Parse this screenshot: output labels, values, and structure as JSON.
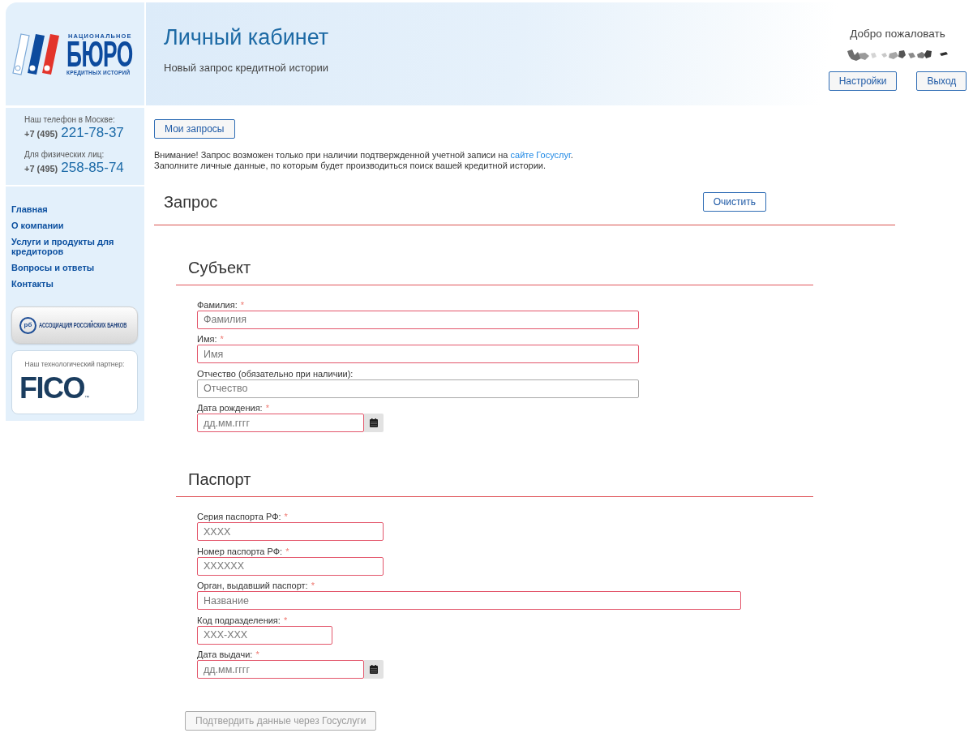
{
  "sidebar": {
    "logo": {
      "top_line": "НАЦИОНАЛЬНОЕ",
      "wordmark": "БЮРО",
      "bottom_line": "КРЕДИТНЫХ ИСТОРИЙ"
    },
    "phones": [
      {
        "label": "Наш телефон в Москве:",
        "code": "+7 (495)",
        "number": "221-78-37"
      },
      {
        "label": "Для физических лиц:",
        "code": "+7 (495)",
        "number": "258-85-74"
      }
    ],
    "nav": [
      {
        "label": "Главная"
      },
      {
        "label": "О компании"
      },
      {
        "label": "Услуги и продукты для кредиторов"
      },
      {
        "label": "Вопросы и ответы"
      },
      {
        "label": "Контакты"
      }
    ],
    "partners": [
      {
        "kind": "banner",
        "emblem": "рб",
        "name": "АССОЦИАЦИЯ РОССИЙСКИХ БАНКОВ"
      },
      {
        "kind": "card",
        "caption": "Наш технологический партнер:",
        "name": "FICO",
        "trademark": "™"
      }
    ]
  },
  "header": {
    "title": "Личный кабинет",
    "subtitle": "Новый запрос кредитной истории",
    "welcome": "Добро пожаловать",
    "buttons": [
      "Настройки",
      "Выход"
    ]
  },
  "my_requests_button": "Мои запросы",
  "notice": {
    "before_link": "Внимание! Запрос возможен только при наличии подтвержденной учетной записи на ",
    "link": "сайте Госуслуг",
    "after_link": ".",
    "second_line": "Заполните личные данные, по которым будет производиться поиск вашей кредитной истории."
  },
  "form": {
    "title": "Запрос",
    "clear_button": "Очистить",
    "sections": [
      {
        "title": "Субъект",
        "fields": [
          {
            "kind": "text",
            "label": "Фамилия:",
            "asterisk": "*",
            "placeholder": "Фамилия",
            "invalid": true
          },
          {
            "kind": "text",
            "label": "Имя:",
            "asterisk": "*",
            "placeholder": "Имя",
            "invalid": true
          },
          {
            "kind": "text",
            "label": "Отчество (обязательно при наличии):",
            "placeholder": "Отчество",
            "invalid": false
          },
          {
            "kind": "date",
            "label": "Дата рождения:",
            "asterisk": "*",
            "placeholder": "дд.мм.гггг",
            "invalid": true
          }
        ]
      },
      {
        "title": "Паспорт",
        "fields": [
          {
            "kind": "number",
            "label": "Серия паспорта РФ:",
            "asterisk": "*",
            "placeholder": "XXXX",
            "invalid": true
          },
          {
            "kind": "number",
            "label": "Номер паспорта РФ:",
            "asterisk": "*",
            "placeholder": "XXXXXX",
            "invalid": true
          },
          {
            "kind": "text",
            "label": "Орган, выдавший паспорт:",
            "asterisk": "*",
            "placeholder": "Название",
            "invalid": true
          },
          {
            "kind": "code",
            "label": "Код подразделения:",
            "asterisk": "*",
            "placeholder": "XXX-XXX",
            "invalid": true
          },
          {
            "kind": "date",
            "label": "Дата выдачи:",
            "asterisk": "*",
            "placeholder": "дд.мм.гггг",
            "invalid": true
          }
        ]
      }
    ],
    "submit": {
      "label": "Подтвердить данные через Госуслуги",
      "disabled": true
    }
  }
}
